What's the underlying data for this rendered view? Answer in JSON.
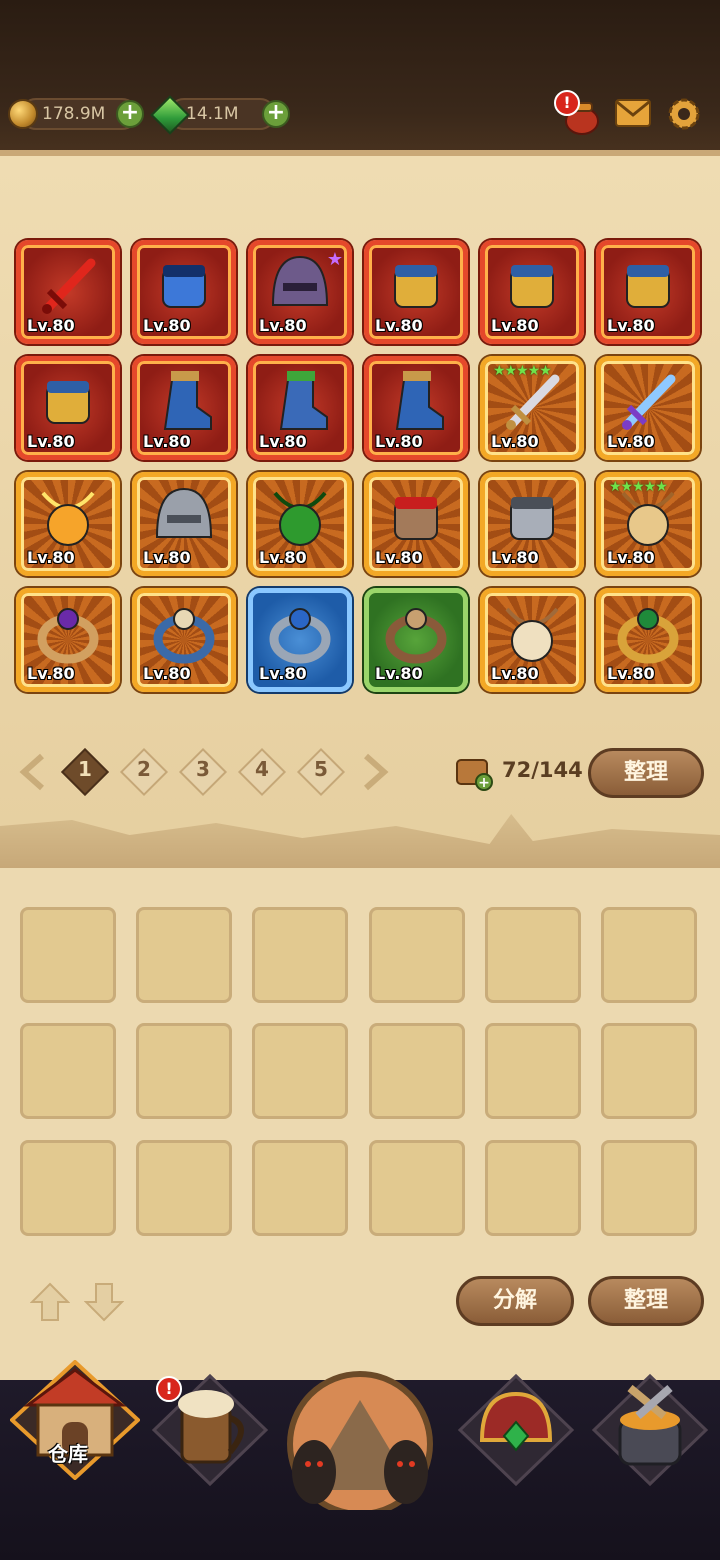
{
  "currency": {
    "gold": "178.9M",
    "gems": "14.1M"
  },
  "icons": {
    "gold": "gold-coin-icon",
    "gems": "green-gem-icon",
    "plus": "plus-icon",
    "event": "event-pot-icon",
    "mail": "mail-icon",
    "settings": "gear-icon",
    "bag": "bag-icon"
  },
  "inventory": {
    "items": [
      {
        "level": "Lv.80",
        "rarity": "red",
        "icon": "red-scimitar-icon"
      },
      {
        "level": "Lv.80",
        "rarity": "red",
        "icon": "blue-gauntlet-icon"
      },
      {
        "level": "Lv.80",
        "rarity": "red",
        "icon": "skull-hood-icon",
        "star": "★"
      },
      {
        "level": "Lv.80",
        "rarity": "red",
        "icon": "gold-gauntlet-icon"
      },
      {
        "level": "Lv.80",
        "rarity": "red",
        "icon": "gold-gauntlet-icon"
      },
      {
        "level": "Lv.80",
        "rarity": "red",
        "icon": "gold-gauntlet-icon"
      },
      {
        "level": "Lv.80",
        "rarity": "red",
        "icon": "gold-gauntlet-icon"
      },
      {
        "level": "Lv.80",
        "rarity": "red",
        "icon": "boot-icon"
      },
      {
        "level": "Lv.80",
        "rarity": "red",
        "icon": "leaf-boot-icon"
      },
      {
        "level": "Lv.80",
        "rarity": "red",
        "icon": "boot-icon"
      },
      {
        "level": "Lv.80",
        "rarity": "orange",
        "icon": "dagger-icon",
        "stars": "★★★★★"
      },
      {
        "level": "Lv.80",
        "rarity": "orange",
        "icon": "magic-sword-icon"
      },
      {
        "level": "Lv.80",
        "rarity": "orange",
        "icon": "sun-amulet-icon"
      },
      {
        "level": "Lv.80",
        "rarity": "orange",
        "icon": "iron-helmet-icon"
      },
      {
        "level": "Lv.80",
        "rarity": "orange",
        "icon": "green-pendant-icon"
      },
      {
        "level": "Lv.80",
        "rarity": "orange",
        "icon": "eye-gauntlet-icon"
      },
      {
        "level": "Lv.80",
        "rarity": "orange",
        "icon": "steel-gauntlet-icon"
      },
      {
        "level": "Lv.80",
        "rarity": "orange",
        "icon": "horn-necklace-icon",
        "stars": "★★★★★"
      },
      {
        "level": "Lv.80",
        "rarity": "orange",
        "icon": "amethyst-ring-icon"
      },
      {
        "level": "Lv.80",
        "rarity": "orange",
        "icon": "fang-ring-icon"
      },
      {
        "level": "Lv.80",
        "rarity": "blue",
        "icon": "eye-ring-icon"
      },
      {
        "level": "Lv.80",
        "rarity": "green",
        "icon": "claw-ring-icon"
      },
      {
        "level": "Lv.80",
        "rarity": "orange",
        "icon": "fang-necklace-icon"
      },
      {
        "level": "Lv.80",
        "rarity": "orange",
        "icon": "emerald-ring-icon"
      }
    ],
    "pages": [
      "1",
      "2",
      "3",
      "4",
      "5"
    ],
    "active_page": 0,
    "capacity": "72/144",
    "sort_label": "整理"
  },
  "lower": {
    "slots": 18,
    "decompose_label": "分解",
    "sort_label": "整理"
  },
  "nav": {
    "warehouse_label": "仓库",
    "tavern_badge": "!",
    "event_badge": "!"
  }
}
